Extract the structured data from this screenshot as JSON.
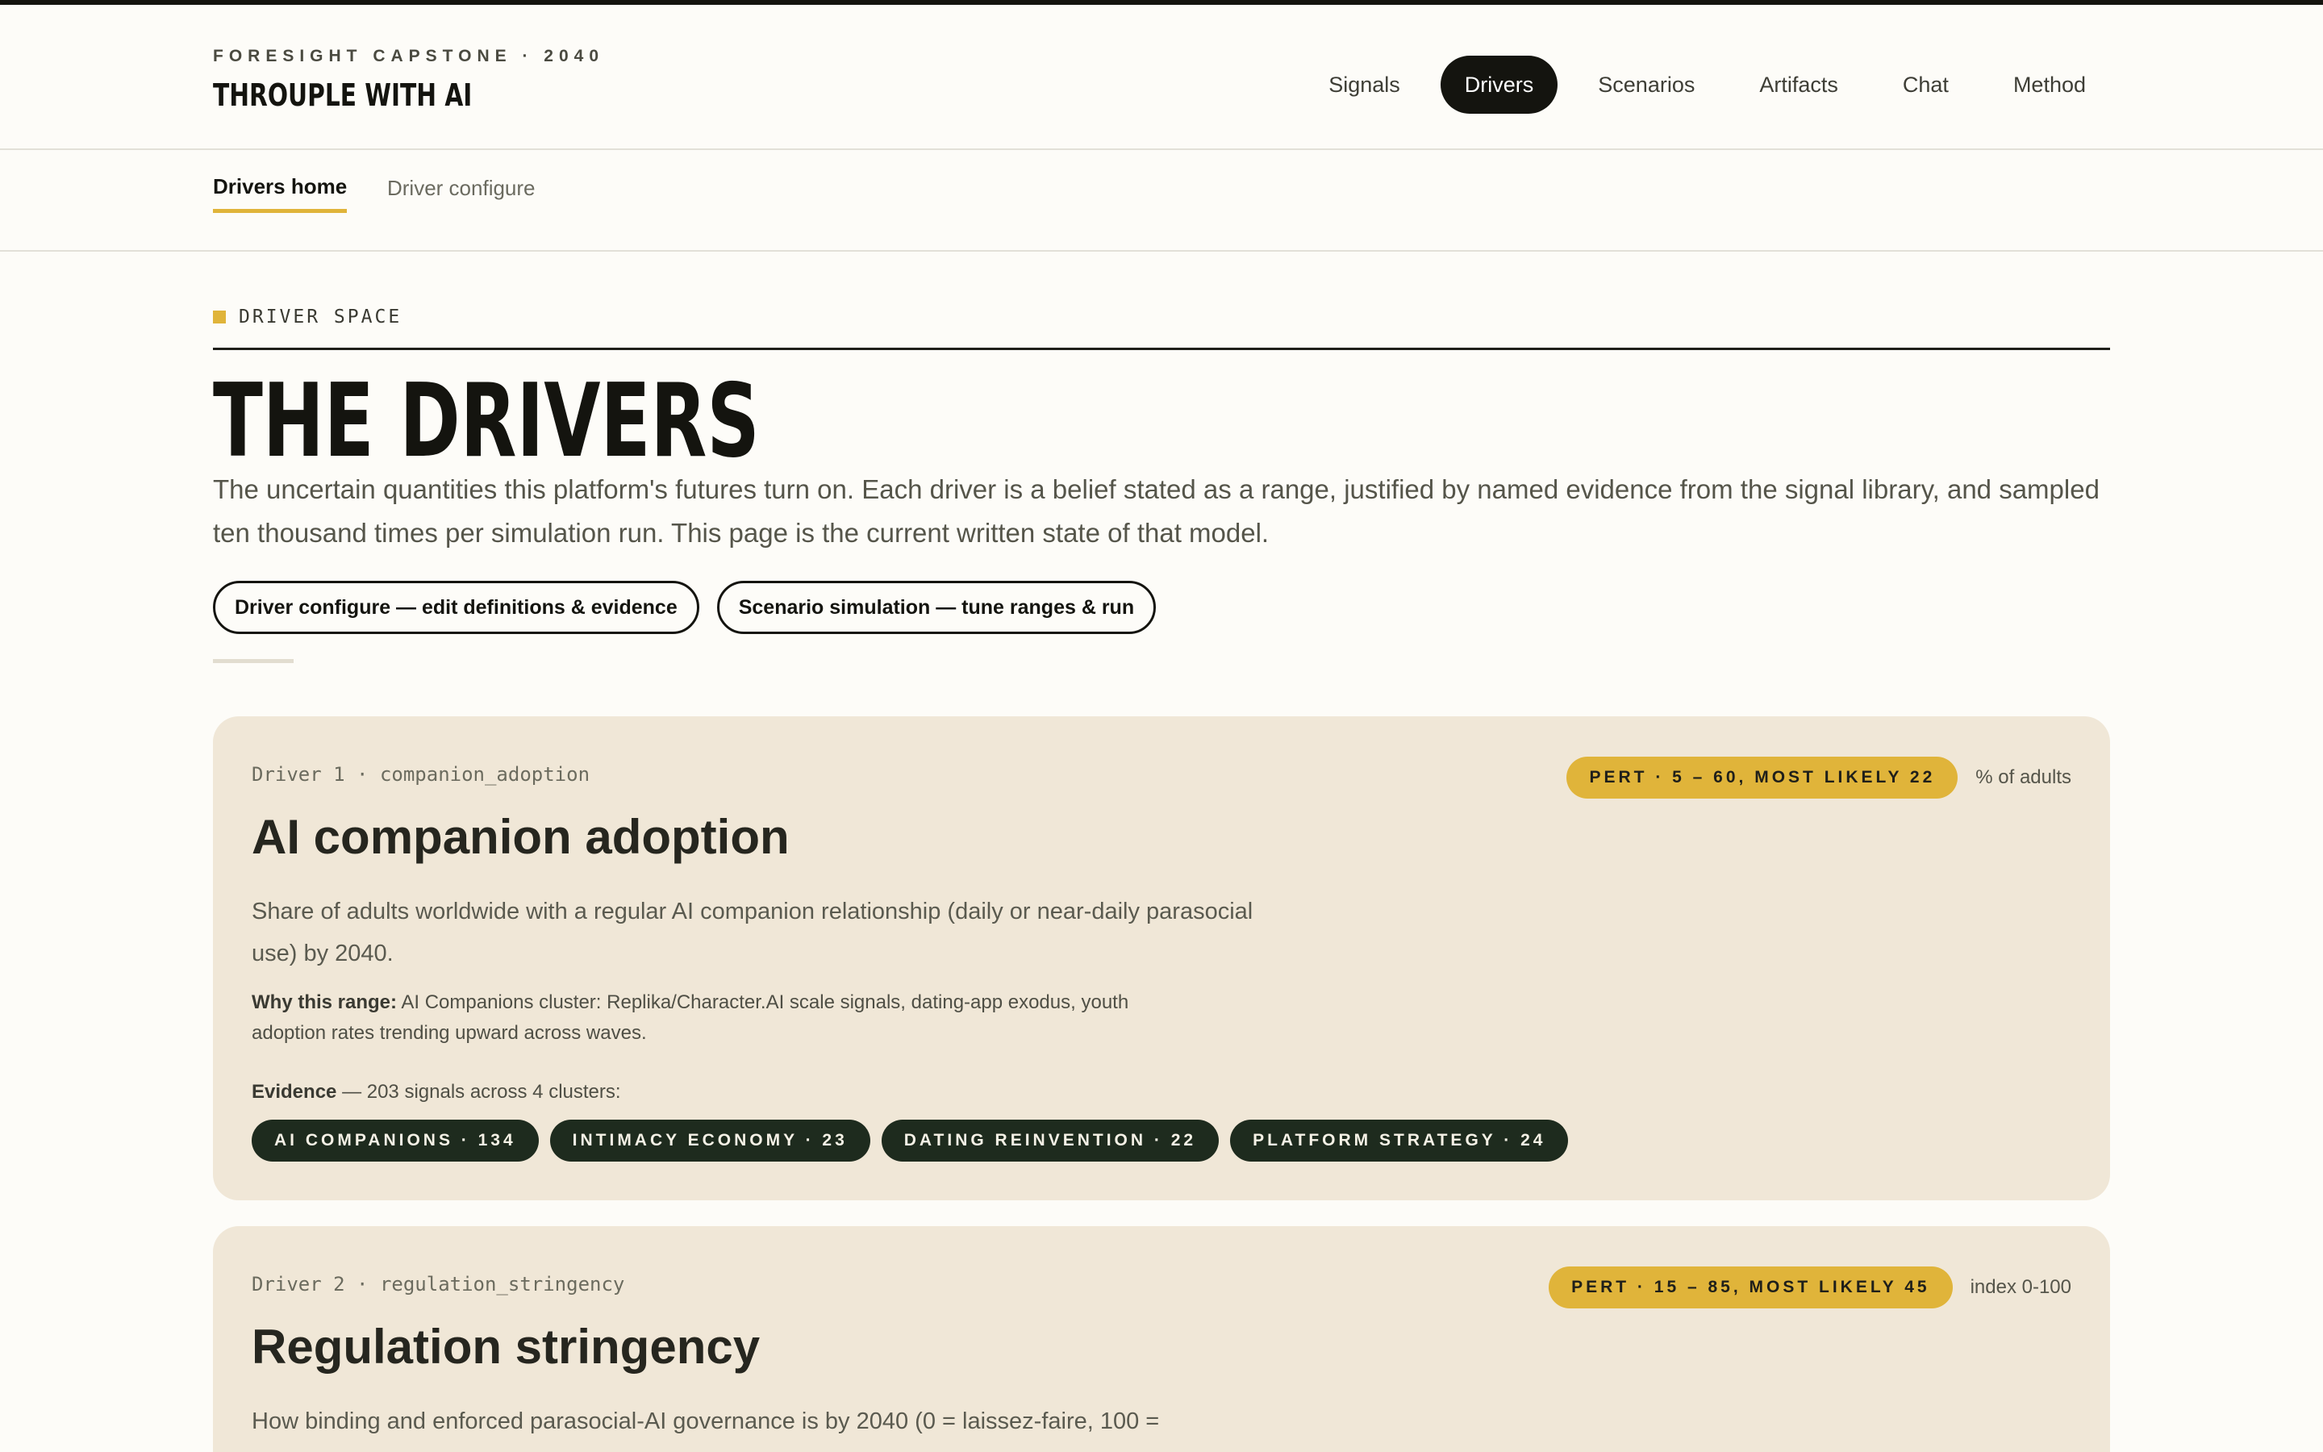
{
  "site": {
    "kicker": "FORESIGHT CAPSTONE · 2040",
    "brand": "THROUPLE WITH AI"
  },
  "nav": {
    "items": [
      {
        "label": "Signals"
      },
      {
        "label": "Drivers",
        "active": true
      },
      {
        "label": "Scenarios"
      },
      {
        "label": "Artifacts"
      },
      {
        "label": "Chat"
      },
      {
        "label": "Method"
      }
    ]
  },
  "subnav": {
    "active": "Drivers home",
    "other": "Driver configure"
  },
  "section": {
    "label": "DRIVER SPACE",
    "title": "THE DRIVERS",
    "intro": "The uncertain quantities this platform's futures turn on. Each driver is a belief stated as a range, justified by named evidence from the signal library, and sampled ten thousand times per simulation run. This page is the current written state of that model.",
    "buttons": [
      "Driver configure — edit definitions & evidence",
      "Scenario simulation — tune ranges & run"
    ]
  },
  "drivers": [
    {
      "meta": "Driver 1 · companion_adoption",
      "range": "PERT · 5 – 60, MOST LIKELY 22",
      "unit": "% of adults",
      "title": "AI companion adoption",
      "description": "Share of adults worldwide with a regular AI companion relationship (daily or near-daily parasocial use) by 2040.",
      "why_label": "Why this range:",
      "why_text": "AI Companions cluster: Replika/Character.AI scale signals, dating-app exodus, youth adoption rates trending upward across waves.",
      "evidence_label": "Evidence",
      "evidence_text": "— 203 signals across 4 clusters:",
      "tags": [
        "AI COMPANIONS · 134",
        "INTIMACY ECONOMY · 23",
        "DATING REINVENTION · 22",
        "PLATFORM STRATEGY · 24"
      ]
    },
    {
      "meta": "Driver 2 · regulation_stringency",
      "range": "PERT · 15 – 85, MOST LIKELY 45",
      "unit": "index 0-100",
      "title": "Regulation stringency",
      "description": "How binding and enforced parasocial-AI governance is by 2040 (0 = laissez-faire, 100 ="
    }
  ]
}
